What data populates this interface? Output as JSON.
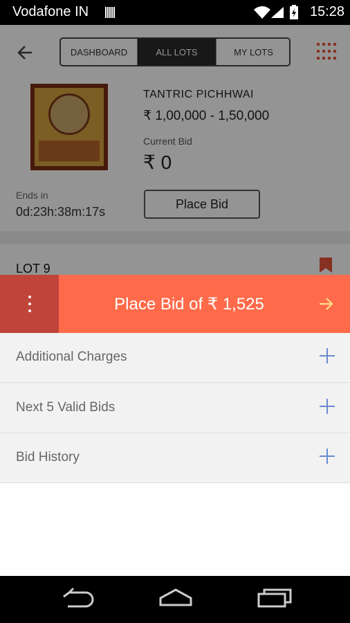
{
  "status": {
    "carrier": "Vodafone IN",
    "time": "15:28"
  },
  "nav": {
    "tabs": [
      "DASHBOARD",
      "ALL LOTS",
      "MY LOTS"
    ],
    "active_tab": "ALL LOTS"
  },
  "lot": {
    "title": "TANTRIC PICHHWAI",
    "estimate": "₹ 1,00,000 -  1,50,000",
    "current_bid_label": "Current Bid",
    "current_bid": "₹ 0",
    "ends_in_label": "Ends in",
    "ends_in": "0d:23h:38m:17s",
    "place_bid": "Place Bid"
  },
  "next_lot": {
    "title": "LOT 9"
  },
  "bid_bar": {
    "label": "Place Bid of ₹ 1,525"
  },
  "panel": {
    "items": [
      "Additional Charges",
      "Next 5 Valid Bids",
      "Bid History"
    ]
  },
  "colors": {
    "accent": "#ff6b4a",
    "menu": "#c0443a",
    "plus": "#6a8ad0"
  },
  "icons": {
    "back": "arrow-left-icon",
    "grid": "grid-icon",
    "bookmark": "bookmark-icon",
    "more": "more-vertical-icon",
    "arrow": "arrow-right-icon",
    "plus": "plus-icon"
  }
}
